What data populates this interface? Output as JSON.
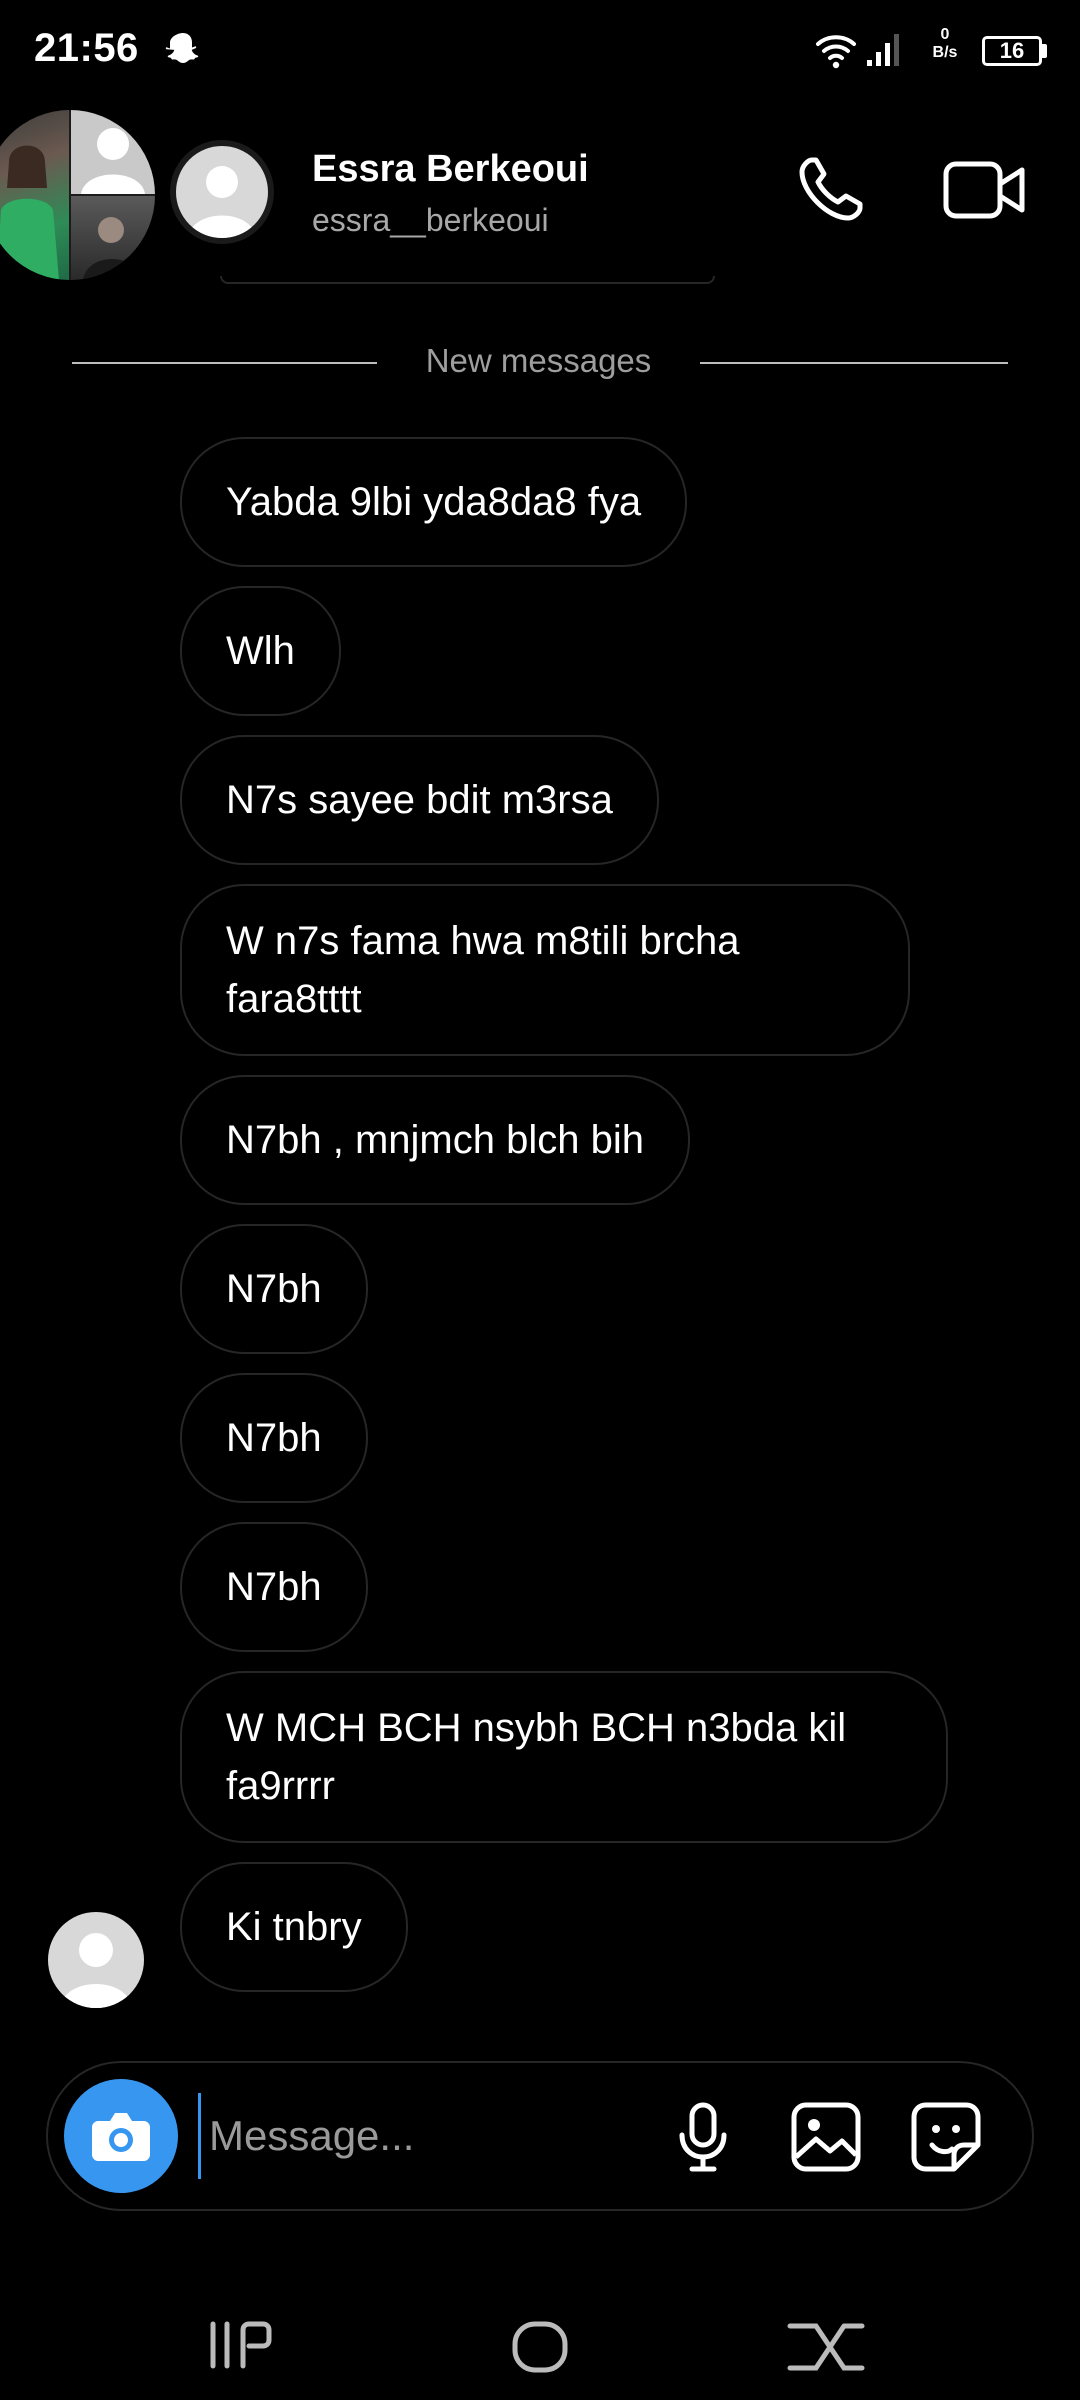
{
  "status_bar": {
    "time": "21:56",
    "netspeed_value": "0",
    "netspeed_unit": "B/s",
    "battery": "16"
  },
  "header": {
    "name": "Essra Berkeoui",
    "handle": "essra__berkeoui"
  },
  "divider": {
    "label": "New messages"
  },
  "messages": [
    "Yabda 9lbi yda8da8 fya",
    "Wlh",
    "N7s sayee bdit m3rsa",
    "W n7s fama hwa m8tili brcha fara8tttt",
    "N7bh , mnjmch blch bih",
    "N7bh",
    "N7bh",
    "N7bh",
    "W MCH BCH nsybh BCH n3bda kil fa9rrrr",
    "Ki tnbry"
  ],
  "composer": {
    "placeholder": "Message..."
  },
  "icons": {
    "status": [
      "snapchat-icon",
      "wifi-icon",
      "signal-icon",
      "battery-icon"
    ],
    "header": [
      "phone-icon",
      "video-camera-icon"
    ],
    "composer": [
      "camera-icon",
      "microphone-icon",
      "gallery-icon",
      "sticker-icon"
    ],
    "nav": [
      "recents-icon",
      "home-icon",
      "back-icon"
    ]
  },
  "colors": {
    "background": "#000000",
    "bubble_border": "#262626",
    "accent": "#3797f0",
    "muted_text": "#a8a8a8"
  }
}
